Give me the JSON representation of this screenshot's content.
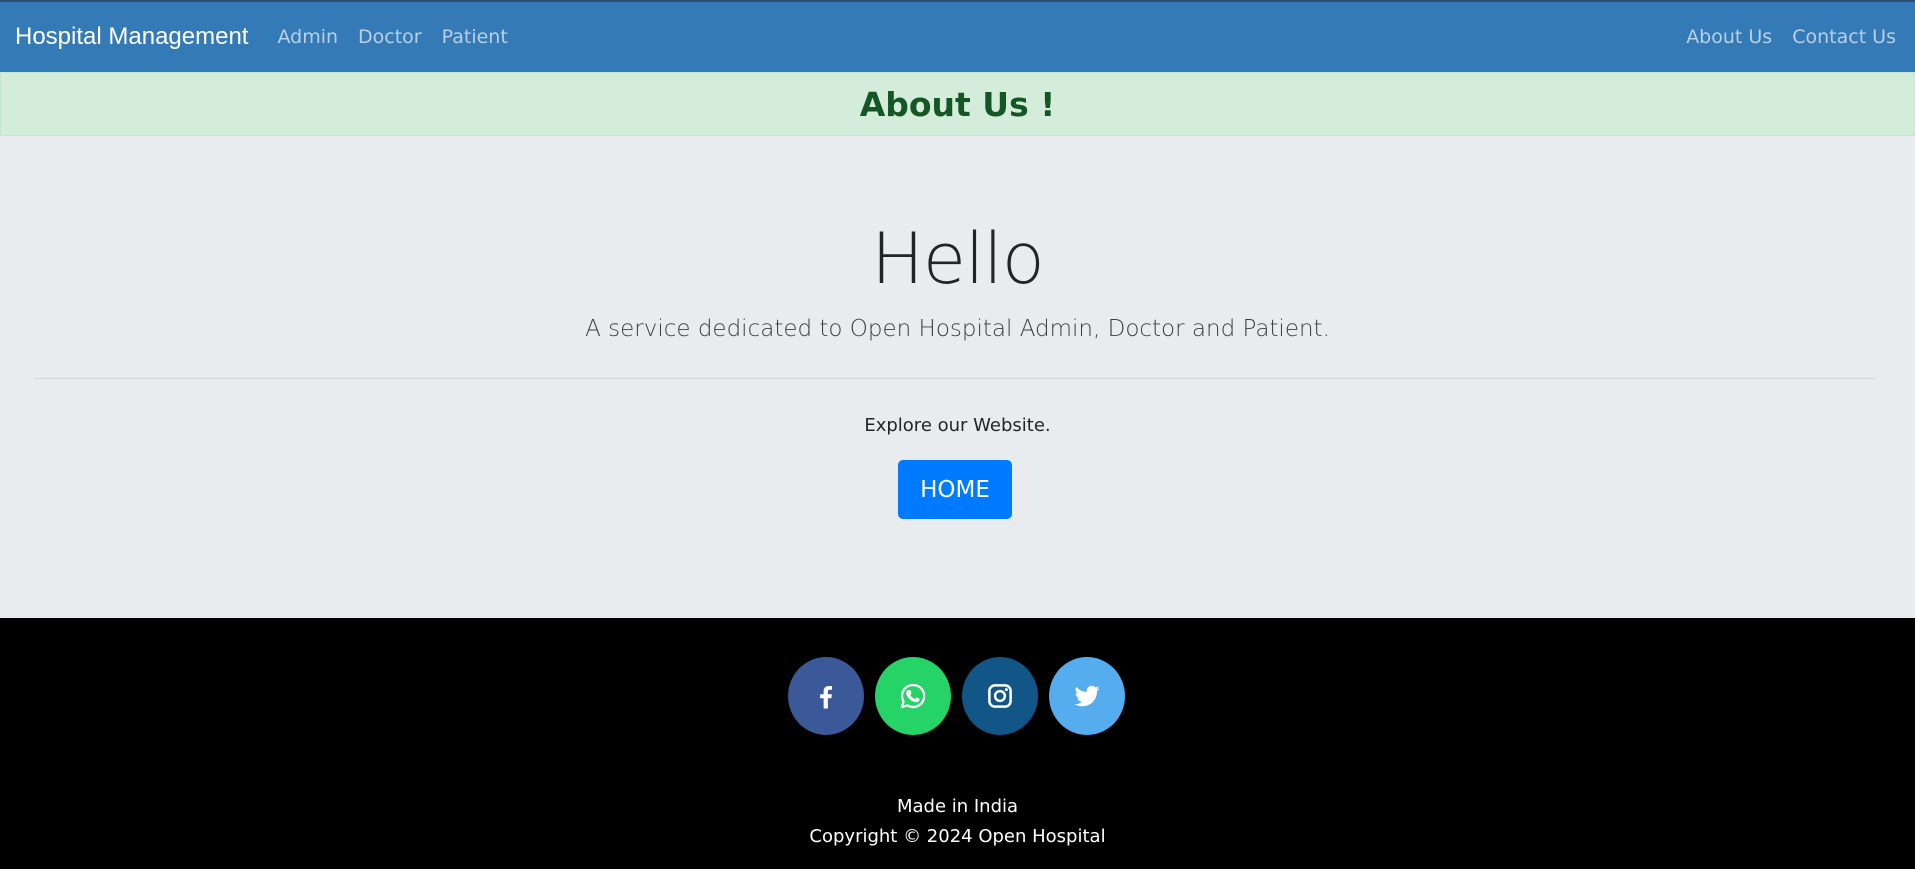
{
  "navbar": {
    "brand": "Hospital Management",
    "left_links": [
      "Admin",
      "Doctor",
      "Patient"
    ],
    "right_links": [
      "About Us",
      "Contact Us"
    ]
  },
  "alert": {
    "title": "About Us !"
  },
  "jumbotron": {
    "heading": "Hello",
    "lead": "A service dedicated to Open Hospital Admin, Doctor and Patient.",
    "explore": "Explore our Website.",
    "home_button": "HOME"
  },
  "footer": {
    "socials": [
      {
        "name": "facebook-icon",
        "color": "#3b5998"
      },
      {
        "name": "whatsapp-icon",
        "color": "#25d366"
      },
      {
        "name": "instagram-icon",
        "color": "#125688"
      },
      {
        "name": "twitter-icon",
        "color": "#55acee"
      }
    ],
    "made_in": "Made in India",
    "copyright": "Copyright © 2024 Open Hospital"
  }
}
